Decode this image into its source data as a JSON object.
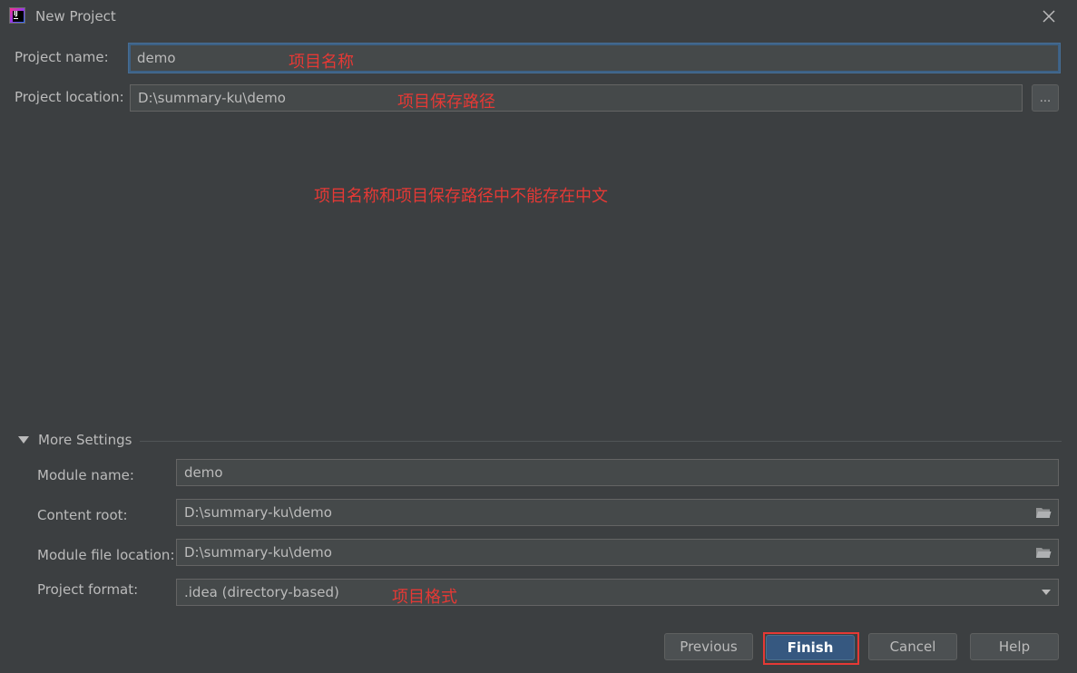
{
  "window": {
    "title": "New Project",
    "icon": "intellij-icon",
    "icon_text": "IJ",
    "close_icon": "close-icon"
  },
  "project": {
    "name_label": "Project name:",
    "name_value": "demo",
    "location_label": "Project location:",
    "location_value": "D:\\summary-ku\\demo",
    "browse_label": "..."
  },
  "annotations": {
    "name_note": "项目名称",
    "location_note": "项目保存路径",
    "warning_note": "项目名称和项目保存路径中不能存在中文",
    "format_note": "项目格式"
  },
  "more_settings": {
    "title": "More Settings",
    "expanded": true,
    "module_name_label": "Module name:",
    "module_name_value": "demo",
    "content_root_label": "Content root:",
    "content_root_value": "D:\\summary-ku\\demo",
    "module_file_label": "Module file location:",
    "module_file_value": "D:\\summary-ku\\demo",
    "format_label": "Project format:",
    "format_value": ".idea (directory-based)"
  },
  "buttons": {
    "previous": "Previous",
    "finish": "Finish",
    "cancel": "Cancel",
    "help": "Help"
  },
  "colors": {
    "background": "#3c3f41",
    "field_bg": "#45494a",
    "primary_button": "#365880",
    "focus_border": "#3d6185",
    "annotation_red": "#e53935"
  }
}
